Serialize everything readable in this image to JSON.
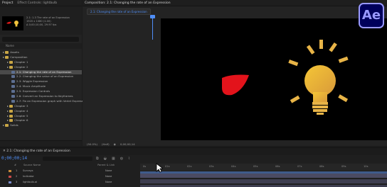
{
  "project_panel": {
    "tabs": [
      "Project",
      "Effect Controls: lightbulb"
    ],
    "info_lines": [
      "2.1: 1.3 The rate of an Expression",
      "1920 x 1080 (1.00)",
      "Δ 0;00;10;00, 29.97 fps"
    ],
    "header": "Name",
    "tree": [
      {
        "label": "Assets",
        "type": "folder",
        "indent": 0
      },
      {
        "label": "Composition",
        "type": "folder",
        "indent": 0
      },
      {
        "label": "Chapter 1",
        "type": "folder",
        "indent": 1
      },
      {
        "label": "Chapter 2",
        "type": "folder",
        "indent": 1
      },
      {
        "label": "2.1: Changing the rate of an Expression",
        "type": "comp",
        "indent": 2,
        "selected": true
      },
      {
        "label": "2.2: Changing the value of an Expression",
        "type": "comp",
        "indent": 2
      },
      {
        "label": "2.3: Wiggle Expression",
        "type": "comp",
        "indent": 2
      },
      {
        "label": "2.4: Music Amplitude",
        "type": "comp",
        "indent": 2
      },
      {
        "label": "2.5: Expression Controls",
        "type": "comp",
        "indent": 2
      },
      {
        "label": "2.6: Convert an Expression to Keyframes",
        "type": "comp",
        "indent": 2
      },
      {
        "label": "2.7: Fix an Expression graph with Verlet Expressions",
        "type": "comp",
        "indent": 2
      },
      {
        "label": "Chapter 3",
        "type": "folder",
        "indent": 1
      },
      {
        "label": "Chapter 4",
        "type": "folder",
        "indent": 1
      },
      {
        "label": "Chapter 5",
        "type": "folder",
        "indent": 1
      },
      {
        "label": "Chapter 6",
        "type": "folder",
        "indent": 1
      },
      {
        "label": "Solids",
        "type": "folder",
        "indent": 0
      }
    ]
  },
  "composition_panel": {
    "tab": "Composition: 2.1: Changing the rate of an Expression",
    "crumb": "2.1: Changing the rate of an Expression",
    "footer": [
      "(50.0%)",
      "(Half)",
      "0;00;00;14"
    ]
  },
  "app": {
    "logo_text": "Ae",
    "logo_bg": "#00005b",
    "logo_fg": "#9999ff"
  },
  "timeline": {
    "tab": "2.1: Changing the rate of an Expression",
    "timecode": "0;00;00;14",
    "columns": [
      "#",
      "Source Name",
      "Parent & Link"
    ],
    "layers": [
      {
        "num": "1",
        "name": "Sunrays",
        "mode": "None",
        "color": "#c98a3a"
      },
      {
        "num": "2",
        "name": "Indicator",
        "mode": "None",
        "color": "#c94a4a"
      },
      {
        "num": "3",
        "name": "lightbulb.ai",
        "mode": "None",
        "color": "#7a8bc9"
      }
    ],
    "ruler_ticks": [
      "0s",
      "01s",
      "02s",
      "03s",
      "04s",
      "05s",
      "06s",
      "07s",
      "08s",
      "09s",
      "10s"
    ]
  }
}
